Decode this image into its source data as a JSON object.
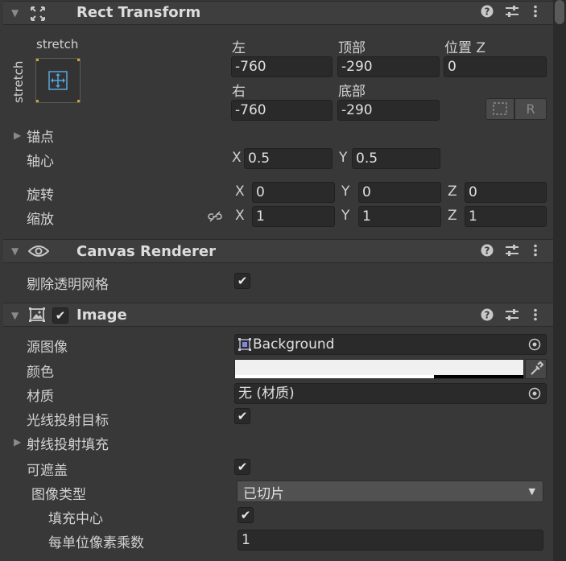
{
  "rect_transform": {
    "title": "Rect Transform",
    "anchor_preset_h": "stretch",
    "anchor_preset_v": "stretch",
    "labels": {
      "left": "左",
      "top": "顶部",
      "pos_z": "位置 Z",
      "right": "右",
      "bottom": "底部"
    },
    "values": {
      "left": "-760",
      "top": "-290",
      "pos_z": "0",
      "right": "-760",
      "bottom": "-290"
    },
    "anchors_label": "锚点",
    "pivot_label": "轴心",
    "pivot": {
      "x_label": "X",
      "x": "0.5",
      "y_label": "Y",
      "y": "0.5"
    },
    "rotation_label": "旋转",
    "rotation": {
      "x": "0",
      "y": "0",
      "z": "0"
    },
    "scale_label": "缩放",
    "scale": {
      "x": "1",
      "y": "1",
      "z": "1"
    },
    "axis": {
      "x": "X",
      "y": "Y",
      "z": "Z"
    },
    "raw_button": "R"
  },
  "canvas_renderer": {
    "title": "Canvas Renderer",
    "cull_label": "剔除透明网格",
    "cull_checked": true
  },
  "image": {
    "title": "Image",
    "enabled": true,
    "source_label": "源图像",
    "source_value": "Background",
    "color_label": "颜色",
    "color_value": "#f0f0f0",
    "material_label": "材质",
    "material_value": "无 (材质)",
    "raycast_target_label": "光线投射目标",
    "raycast_target_checked": true,
    "raycast_padding_label": "射线投射填充",
    "maskable_label": "可遮盖",
    "maskable_checked": true,
    "image_type_label": "图像类型",
    "image_type_value": "已切片",
    "fill_center_label": "填充中心",
    "fill_center_checked": true,
    "ppu_label": "每单位像素乘数",
    "ppu_value": "1"
  },
  "icons": {
    "help": "question-icon",
    "settings": "sliders-icon",
    "menu": "kebab-icon",
    "check": "✔",
    "chevron_down": "▼",
    "chevron_right": "▶"
  },
  "colors": {
    "accent": "#56a7e0",
    "anchor_gold": "#d1a43a"
  }
}
